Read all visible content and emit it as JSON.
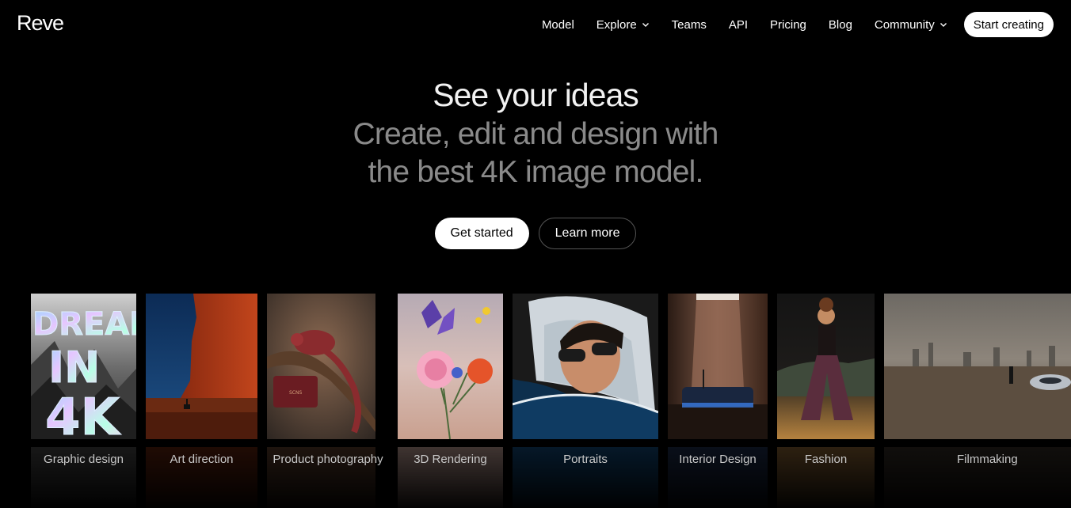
{
  "brand": {
    "logo": "Reve"
  },
  "nav": {
    "items": [
      {
        "label": "Model"
      },
      {
        "label": "Explore"
      },
      {
        "label": "Teams"
      },
      {
        "label": "API"
      },
      {
        "label": "Pricing"
      },
      {
        "label": "Blog"
      },
      {
        "label": "Community"
      }
    ],
    "cta": "Start creating"
  },
  "hero": {
    "title": "See your ideas",
    "subtitle_line1": "Create, edit and design with",
    "subtitle_line2": "the best 4K image model.",
    "primary_button": "Get started",
    "secondary_button": "Learn more"
  },
  "gallery": {
    "items": [
      {
        "label": "Graphic design",
        "art_text_1": "DREAM",
        "art_text_2": "IN",
        "art_text_3": "4K"
      },
      {
        "label": "Art direction"
      },
      {
        "label": "Product photography",
        "bag_text": "SCNS"
      },
      {
        "label": "3D Rendering"
      },
      {
        "label": "Portraits"
      },
      {
        "label": "Interior Design"
      },
      {
        "label": "Fashion"
      },
      {
        "label": "Filmmaking"
      }
    ]
  },
  "colors": {
    "background": "#000000",
    "accent_button": "#ffffff",
    "subtitle": "#8a8a8a"
  }
}
